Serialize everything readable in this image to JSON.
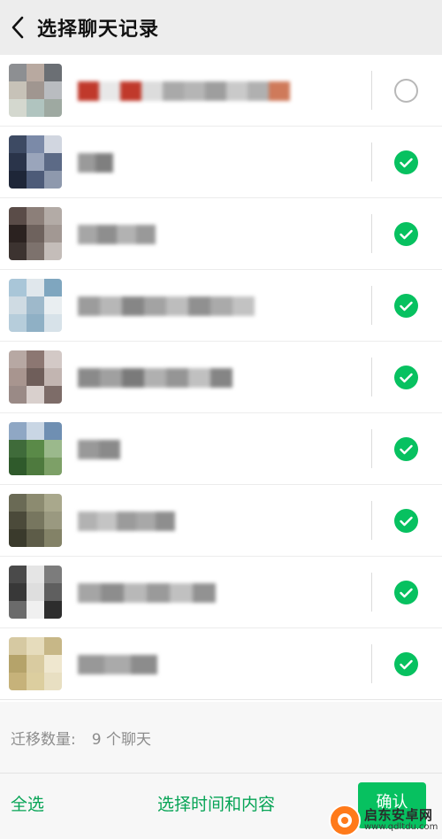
{
  "header": {
    "title": "选择聊天记录",
    "back_icon": "chevron-left-icon"
  },
  "chats": [
    {
      "selected": false,
      "avatar": [
        "#8d8f92",
        "#b8a9a0",
        "#6b6f74",
        "#c7c2b8",
        "#a09690",
        "#b9bcc0",
        "#d4d8cf",
        "#b0c4bf",
        "#9ea9a1"
      ],
      "name_blocks": [
        "#c0392b",
        "#e8e8e8",
        "#c0392b",
        "#dcdcdc",
        "#a9a9a9",
        "#b5b5b5",
        "#9e9e9e",
        "#c9c9c9",
        "#b0b0b0",
        "#cf7a5a"
      ]
    },
    {
      "selected": true,
      "avatar": [
        "#3d4a63",
        "#7b8aa8",
        "#d1d6e0",
        "#2a344a",
        "#9aa5bb",
        "#5c6a86",
        "#1e2638",
        "#4d5b78",
        "#8e99ad"
      ],
      "name_blocks": [
        "#9a9a9a",
        "#7f7f7f"
      ]
    },
    {
      "selected": true,
      "avatar": [
        "#5a4c48",
        "#8c7f79",
        "#b3aba6",
        "#2b2220",
        "#6e625d",
        "#a29893",
        "#3c3330",
        "#7d726d",
        "#c4bdb9"
      ],
      "name_blocks": [
        "#a6a6a6",
        "#8e8e8e",
        "#b2b2b2",
        "#999999"
      ]
    },
    {
      "selected": true,
      "avatar": [
        "#a9c6d8",
        "#e0e7ec",
        "#7fa6bf",
        "#cfdbe3",
        "#9eb9cb",
        "#e9eef1",
        "#b6cddb",
        "#8fb0c5",
        "#d7e2e9"
      ],
      "name_blocks": [
        "#9c9c9c",
        "#b7b7b7",
        "#868686",
        "#a3a3a3",
        "#bdbdbd",
        "#909090",
        "#aaaaaa",
        "#c2c2c2"
      ]
    },
    {
      "selected": true,
      "avatar": [
        "#b7a8a3",
        "#8c7772",
        "#d3c9c6",
        "#a8958f",
        "#6f5e5a",
        "#c2b5b1",
        "#9a8a86",
        "#d9d0cd",
        "#7d6c68"
      ],
      "name_blocks": [
        "#8a8a8a",
        "#a0a0a0",
        "#7a7a7a",
        "#b0b0b0",
        "#959595",
        "#c0c0c0",
        "#858585"
      ]
    },
    {
      "selected": true,
      "avatar": [
        "#8fa7c4",
        "#c9d6e4",
        "#6f8fb2",
        "#3f6b3a",
        "#5a8a48",
        "#9bb98c",
        "#2f5a2b",
        "#4e7a3e",
        "#7da067"
      ],
      "name_blocks": [
        "#999999",
        "#8a8a8a"
      ]
    },
    {
      "selected": true,
      "avatar": [
        "#6a6a55",
        "#8c8b70",
        "#a9a88c",
        "#4b4a3a",
        "#77765f",
        "#9a9980",
        "#3a3a2c",
        "#5d5c48",
        "#838267"
      ],
      "name_blocks": [
        "#b2b2b2",
        "#c4c4c4",
        "#9b9b9b",
        "#a8a8a8",
        "#8e8e8e"
      ]
    },
    {
      "selected": true,
      "avatar": [
        "#4a4a4a",
        "#e5e5e5",
        "#7c7c7c",
        "#383838",
        "#dedede",
        "#5f5f5f",
        "#6b6b6b",
        "#f0f0f0",
        "#2d2d2d"
      ],
      "name_blocks": [
        "#a5a5a5",
        "#8d8d8d",
        "#b8b8b8",
        "#9a9a9a",
        "#c0c0c0",
        "#929292"
      ]
    },
    {
      "selected": true,
      "avatar": [
        "#d6c9a2",
        "#e6dcbc",
        "#c7b787",
        "#b5a36a",
        "#d9cba0",
        "#efe7cf",
        "#c6b27a",
        "#dcce9f",
        "#e8dfc2"
      ],
      "name_blocks": [
        "#989898",
        "#aaaaaa",
        "#8c8c8c"
      ]
    }
  ],
  "migrate": {
    "label": "迁移数量:",
    "count": "9 个聊天"
  },
  "bottom": {
    "select_all": "全选",
    "select_time": "选择时间和内容",
    "confirm": "确认"
  },
  "watermark": {
    "cn": "启东安卓网",
    "url": "www.qdltdu.com",
    "color": "#ff7a1a"
  },
  "colors": {
    "accent": "#07c160",
    "link": "#07a456"
  }
}
